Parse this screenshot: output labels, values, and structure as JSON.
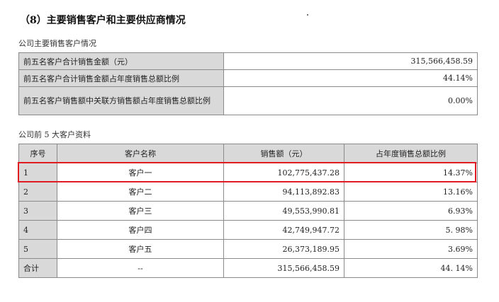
{
  "heading": "（8）主要销售客户和主要供应商情况",
  "summary_title": "公司主要销售客户情况",
  "summary": [
    {
      "label": "前五名客户合计销售金额（元）",
      "value": "315,566,458.59"
    },
    {
      "label": "前五名客户合计销售金额占年度销售总额比例",
      "value": "44.14%"
    },
    {
      "label": "前五名客户销售额中关联方销售额占年度销售总额比例",
      "value": "0.00%"
    }
  ],
  "top5_title": "公司前 5 大客户资料",
  "columns": [
    "序号",
    "客户名称",
    "销售额（元）",
    "占年度销售总额比例"
  ],
  "rows": [
    {
      "idx": "1",
      "name": "客户一",
      "amount": "102,775,437.28",
      "ratio": "14.37%"
    },
    {
      "idx": "2",
      "name": "客户二",
      "amount": "94,113,892.83",
      "ratio": "13.16%"
    },
    {
      "idx": "3",
      "name": "客户三",
      "amount": "49,553,990.81",
      "ratio": "6.93%"
    },
    {
      "idx": "4",
      "name": "客户四",
      "amount": "42,749,947.72",
      "ratio": "5. 98%"
    },
    {
      "idx": "5",
      "name": "客户五",
      "amount": "26,373,189.95",
      "ratio": "3.69%"
    },
    {
      "idx": "合计",
      "name": "--",
      "amount": "315,566,458.59",
      "ratio": "44. 14%"
    }
  ],
  "colors": {
    "highlight": "#e01b24",
    "label_bg": "#d9d9d9"
  }
}
